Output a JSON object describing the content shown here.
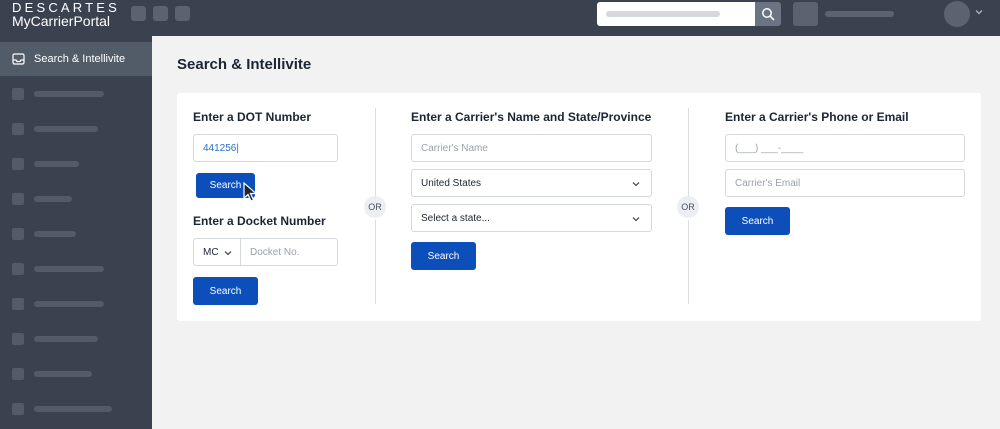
{
  "app": {
    "brand_line1": "DESCARTES",
    "brand_line2": "MyCarrierPortal"
  },
  "topbar": {
    "search_icon": "search-icon",
    "avatar_icon": "chevron-down-icon"
  },
  "sidebar": {
    "active_item": {
      "label": "Search & Intellivite",
      "icon": "inbox-icon"
    },
    "placeholder_items": 11
  },
  "main": {
    "page_title": "Search & Intellivite",
    "dot": {
      "heading": "Enter a DOT Number",
      "value": "441256|",
      "search_label": "Search"
    },
    "docket": {
      "heading": "Enter a Docket Number",
      "prefix": "MC",
      "placeholder": "Docket No.",
      "search_label": "Search"
    },
    "or_label": "OR",
    "carrier_name": {
      "heading": "Enter a Carrier's Name and State/Province",
      "name_placeholder": "Carrier's Name",
      "country": "United States",
      "state_placeholder": "Select a state...",
      "search_label": "Search"
    },
    "phone_email": {
      "heading": "Enter a Carrier's Phone or Email",
      "phone_placeholder": "(___) ___-____",
      "email_placeholder": "Carrier's Email",
      "search_label": "Search"
    }
  },
  "colors": {
    "topbar": "#3a4250",
    "primary_button": "#0d4fba",
    "active_sidebar": "#525b68"
  }
}
